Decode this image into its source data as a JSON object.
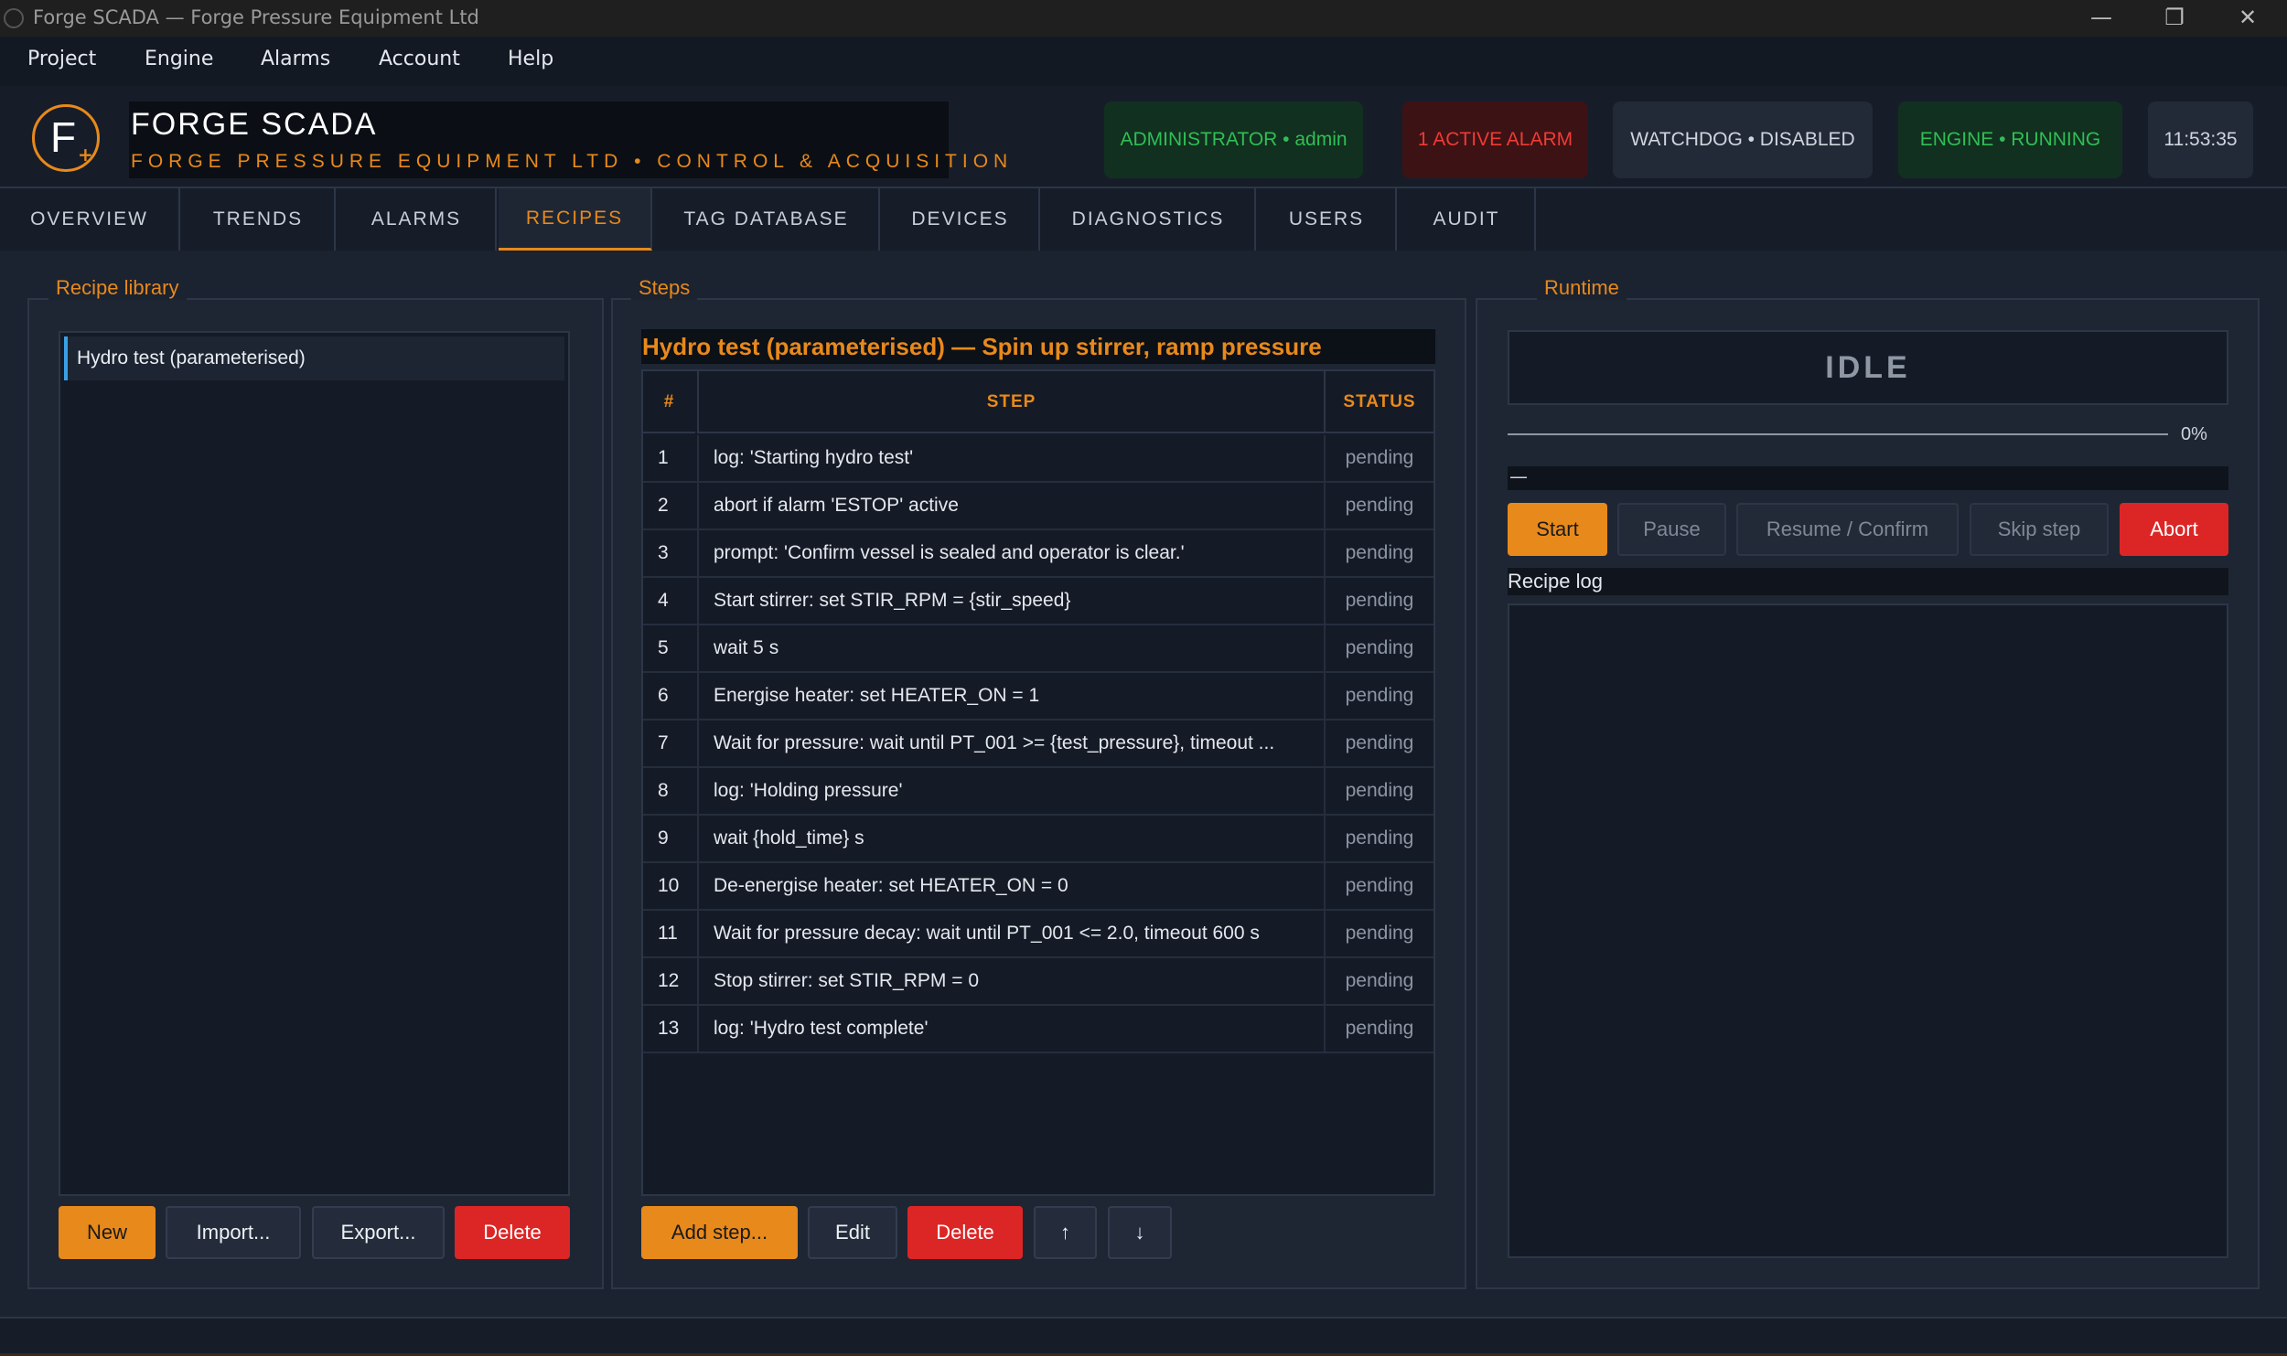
{
  "window": {
    "title": "Forge SCADA — Forge Pressure Equipment Ltd",
    "controls": [
      "—",
      "❐",
      "✕"
    ]
  },
  "menu": [
    "Project",
    "Engine",
    "Alarms",
    "Account",
    "Help"
  ],
  "header": {
    "logo_letter": "F",
    "brand_name": "FORGE SCADA",
    "brand_sub": "FORGE PRESSURE EQUIPMENT LTD  •  CONTROL & ACQUISITION",
    "chips": {
      "user": "ADMINISTRATOR  •  admin",
      "alarm": "1 ACTIVE ALARM",
      "watchdog": "WATCHDOG  •  DISABLED",
      "engine": "ENGINE  •  RUNNING",
      "clock": "11:53:35"
    },
    "colors": {
      "accent": "#e8891b",
      "ok": "#2fbf55",
      "alarm": "#ef3b35"
    }
  },
  "tabs": [
    {
      "label": "OVERVIEW",
      "active": false
    },
    {
      "label": "TRENDS",
      "active": false
    },
    {
      "label": "ALARMS",
      "active": false
    },
    {
      "label": "RECIPES",
      "active": true
    },
    {
      "label": "TAG DATABASE",
      "active": false
    },
    {
      "label": "DEVICES",
      "active": false
    },
    {
      "label": "DIAGNOSTICS",
      "active": false
    },
    {
      "label": "USERS",
      "active": false
    },
    {
      "label": "AUDIT",
      "active": false
    }
  ],
  "library": {
    "title": "Recipe library",
    "items": [
      "Hydro test (parameterised)"
    ],
    "buttons": {
      "new": "New",
      "import": "Import...",
      "export": "Export...",
      "delete": "Delete"
    }
  },
  "steps": {
    "title": "Steps",
    "recipe_name": "Hydro test (parameterised)     — Spin up stirrer, ramp pressure",
    "columns": {
      "num": "#",
      "step": "STEP",
      "status": "STATUS"
    },
    "rows": [
      {
        "num": "1",
        "step": "log: 'Starting hydro test'",
        "status": "pending"
      },
      {
        "num": "2",
        "step": "abort if alarm 'ESTOP' active",
        "status": "pending"
      },
      {
        "num": "3",
        "step": "prompt: 'Confirm vessel is sealed and operator is clear.'",
        "status": "pending"
      },
      {
        "num": "4",
        "step": "Start stirrer: set STIR_RPM = {stir_speed}",
        "status": "pending"
      },
      {
        "num": "5",
        "step": "wait 5 s",
        "status": "pending"
      },
      {
        "num": "6",
        "step": "Energise heater: set HEATER_ON = 1",
        "status": "pending"
      },
      {
        "num": "7",
        "step": "Wait for pressure: wait until PT_001 >= {test_pressure}, timeout ...",
        "status": "pending"
      },
      {
        "num": "8",
        "step": "log: 'Holding pressure'",
        "status": "pending"
      },
      {
        "num": "9",
        "step": "wait {hold_time} s",
        "status": "pending"
      },
      {
        "num": "10",
        "step": "De-energise heater: set HEATER_ON = 0",
        "status": "pending"
      },
      {
        "num": "11",
        "step": "Wait for pressure decay: wait until PT_001 <= 2.0, timeout 600 s",
        "status": "pending"
      },
      {
        "num": "12",
        "step": "Stop stirrer: set STIR_RPM = 0",
        "status": "pending"
      },
      {
        "num": "13",
        "step": "log: 'Hydro test complete'",
        "status": "pending"
      }
    ],
    "buttons": {
      "add": "Add step...",
      "edit": "Edit",
      "delete": "Delete",
      "up": "↑",
      "down": "↓"
    }
  },
  "runtime": {
    "title": "Runtime",
    "state": "IDLE",
    "progress_percent": 0,
    "progress_label": "0%",
    "status_text": "—",
    "buttons": {
      "start": "Start",
      "pause": "Pause",
      "resume": "Resume / Confirm",
      "skip": "Skip step",
      "abort": "Abort"
    },
    "log_label": "Recipe log"
  }
}
